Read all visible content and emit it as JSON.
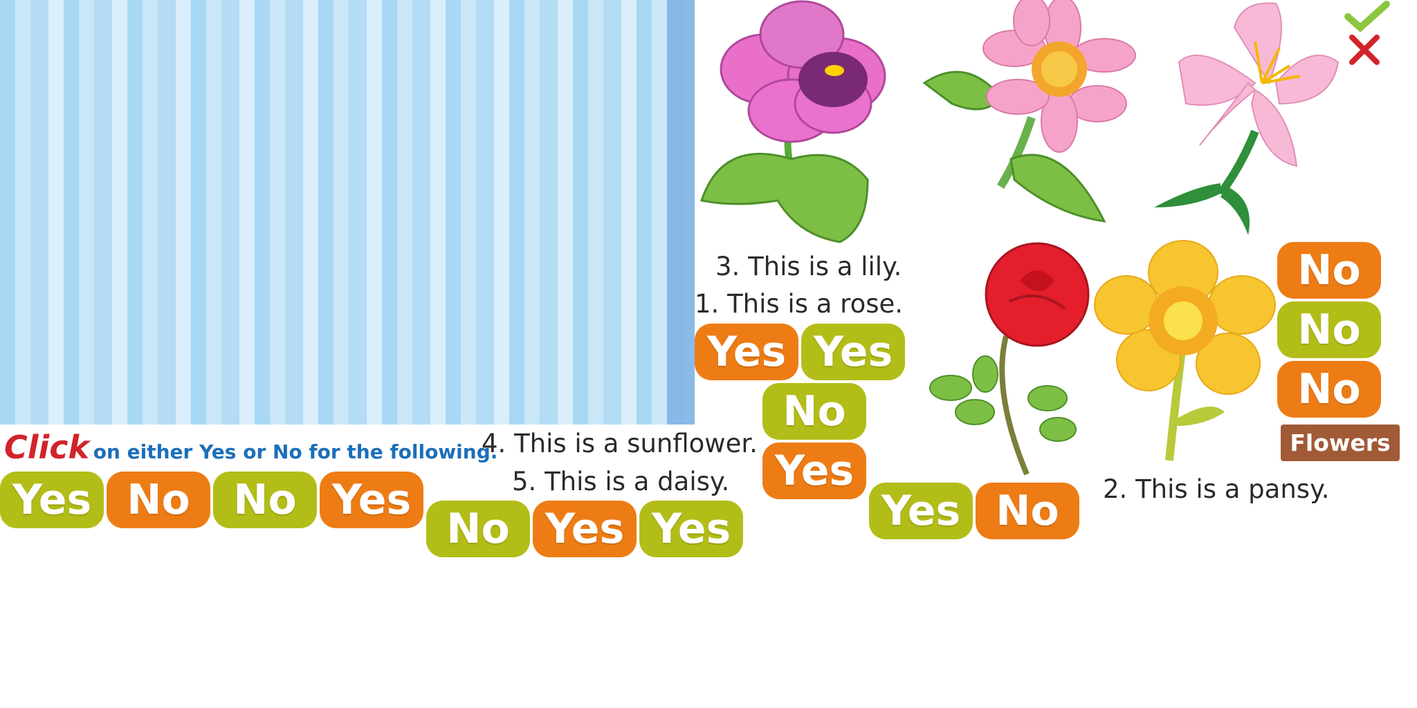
{
  "instruction": {
    "click": "Click",
    "rest": "on either Yes or No for the following."
  },
  "statements": {
    "s3": "3. This is a lily.",
    "s1": "1. This is a rose.",
    "s4": "4. This is a sunflower.",
    "s5": "5. This is a daisy.",
    "s2": "2. This is a pansy."
  },
  "buttons": {
    "row_left": [
      "Yes",
      "No",
      "No",
      "Yes"
    ],
    "row_mid": [
      "No",
      "Yes",
      "Yes"
    ],
    "pair_top": [
      "Yes",
      "Yes"
    ],
    "col_center": [
      "No",
      "Yes"
    ],
    "pair_rose": [
      "Yes",
      "No"
    ],
    "col_right": [
      "No",
      "No",
      "No"
    ]
  },
  "badge": "Flowers",
  "colors": {
    "green": "#b3bd17",
    "orange": "#ee7c15",
    "badge": "#a15a36"
  },
  "icons": [
    "check-icon",
    "cross-icon",
    "curtain",
    "pansy",
    "daisy",
    "lily",
    "rose",
    "sunflower"
  ]
}
